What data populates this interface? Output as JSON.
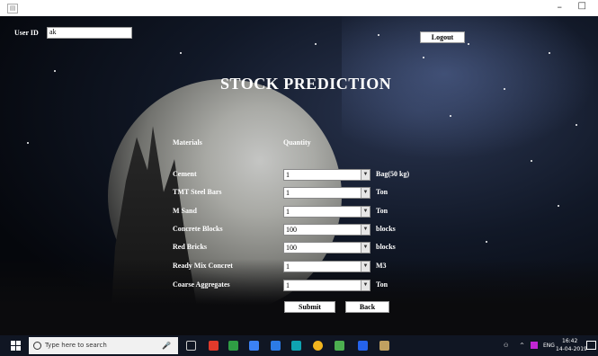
{
  "window": {
    "minimize_glyph": "–",
    "maximize_glyph": "□",
    "app_icon_glyph": "▤"
  },
  "header": {
    "user_id_label": "User ID",
    "user_id_value": "ak",
    "logout_label": "Logout"
  },
  "page": {
    "title": "STOCK PREDICTION"
  },
  "form": {
    "materials_header": "Materials",
    "quantity_header": "Quantity",
    "rows": [
      {
        "material": "Cement",
        "quantity": "1",
        "unit": "Bag(50 kg)"
      },
      {
        "material": "TMT Steel Bars",
        "quantity": "1",
        "unit": "Ton"
      },
      {
        "material": "M Sand",
        "quantity": "1",
        "unit": "Ton"
      },
      {
        "material": "Concrete Blocks",
        "quantity": "100",
        "unit": "blocks"
      },
      {
        "material": "Red Bricks",
        "quantity": "100",
        "unit": "blocks"
      },
      {
        "material": "Ready Mix Concret",
        "quantity": "1",
        "unit": "M3"
      },
      {
        "material": "Coarse Aggregates",
        "quantity": "1",
        "unit": "Ton"
      }
    ],
    "submit_label": "Submit",
    "back_label": "Back"
  },
  "taskbar": {
    "search_placeholder": "Type here to search",
    "language": "ENG",
    "time": "16:42",
    "date": "14-04-2019",
    "icon_colors": [
      "#e03a2b",
      "#2f9e44",
      "#3b82f6",
      "#2c7be5",
      "#0fa3b1",
      "#f2b51e",
      "#4caf50",
      "#2563eb",
      "#c0a060"
    ]
  }
}
